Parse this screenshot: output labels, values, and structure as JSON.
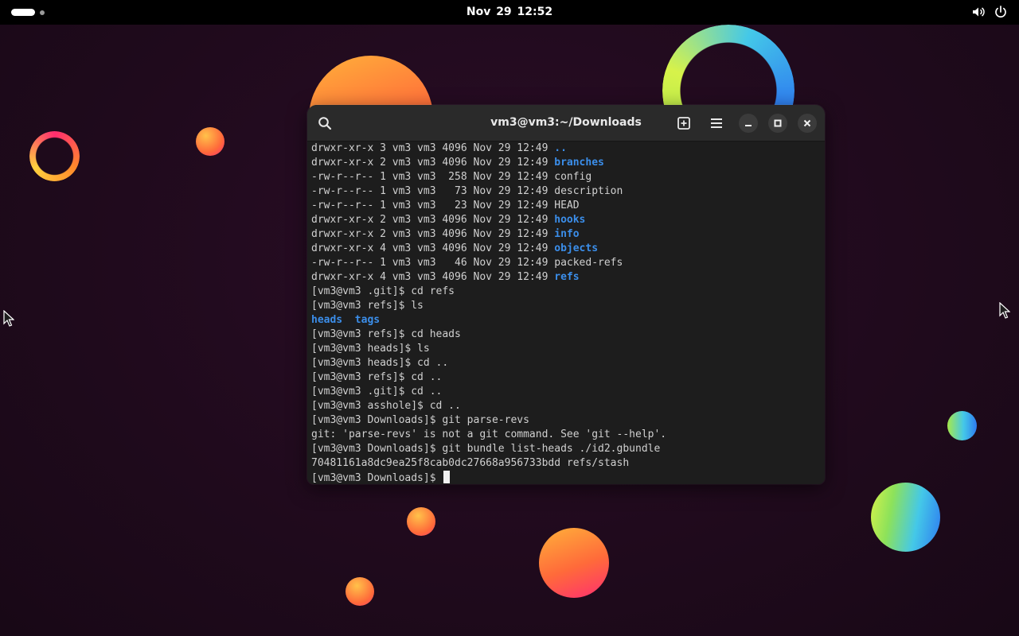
{
  "topbar": {
    "clock": "Nov 29  12:52",
    "tray_icons": [
      "volume-icon",
      "power-icon"
    ]
  },
  "terminal": {
    "title": "vm3@vm3:~/Downloads",
    "header_icons": [
      "search-icon",
      "new-tab-icon",
      "hamburger-menu-icon",
      "minimize-icon",
      "maximize-icon",
      "close-icon"
    ],
    "colors": {
      "directory": "#3b8eea",
      "text": "#d0d0d0",
      "background": "#1d1d1d"
    },
    "lines": [
      [
        {
          "t": "drwxr-xr-x 3 vm3 vm3 4096 Nov 29 12:49 "
        },
        {
          "t": "..",
          "c": "dir"
        }
      ],
      [
        {
          "t": "drwxr-xr-x 2 vm3 vm3 4096 Nov 29 12:49 "
        },
        {
          "t": "branches",
          "c": "dir"
        }
      ],
      [
        {
          "t": "-rw-r--r-- 1 vm3 vm3  258 Nov 29 12:49 config"
        }
      ],
      [
        {
          "t": "-rw-r--r-- 1 vm3 vm3   73 Nov 29 12:49 description"
        }
      ],
      [
        {
          "t": "-rw-r--r-- 1 vm3 vm3   23 Nov 29 12:49 HEAD"
        }
      ],
      [
        {
          "t": "drwxr-xr-x 2 vm3 vm3 4096 Nov 29 12:49 "
        },
        {
          "t": "hooks",
          "c": "dir"
        }
      ],
      [
        {
          "t": "drwxr-xr-x 2 vm3 vm3 4096 Nov 29 12:49 "
        },
        {
          "t": "info",
          "c": "dir"
        }
      ],
      [
        {
          "t": "drwxr-xr-x 4 vm3 vm3 4096 Nov 29 12:49 "
        },
        {
          "t": "objects",
          "c": "dir"
        }
      ],
      [
        {
          "t": "-rw-r--r-- 1 vm3 vm3   46 Nov 29 12:49 packed-refs"
        }
      ],
      [
        {
          "t": "drwxr-xr-x 4 vm3 vm3 4096 Nov 29 12:49 "
        },
        {
          "t": "refs",
          "c": "dir"
        }
      ],
      [
        {
          "t": "[vm3@vm3 .git]$ cd refs"
        }
      ],
      [
        {
          "t": "[vm3@vm3 refs]$ ls"
        }
      ],
      [
        {
          "t": "heads",
          "c": "dir"
        },
        {
          "t": "  "
        },
        {
          "t": "tags",
          "c": "dir"
        }
      ],
      [
        {
          "t": "[vm3@vm3 refs]$ cd heads"
        }
      ],
      [
        {
          "t": "[vm3@vm3 heads]$ ls"
        }
      ],
      [
        {
          "t": "[vm3@vm3 heads]$ cd .."
        }
      ],
      [
        {
          "t": "[vm3@vm3 refs]$ cd .."
        }
      ],
      [
        {
          "t": "[vm3@vm3 .git]$ cd .."
        }
      ],
      [
        {
          "t": "[vm3@vm3 asshole]$ cd .."
        }
      ],
      [
        {
          "t": "[vm3@vm3 Downloads]$ git parse-revs"
        }
      ],
      [
        {
          "t": "git: 'parse-revs' is not a git command. See 'git --help'."
        }
      ],
      [
        {
          "t": "[vm3@vm3 Downloads]$ git bundle list-heads ./id2.gbundle"
        }
      ],
      [
        {
          "t": "70481161a8dc9ea25f8cab0dc27668a956733bdd refs/stash"
        }
      ]
    ],
    "prompt": "[vm3@vm3 Downloads]$ "
  }
}
